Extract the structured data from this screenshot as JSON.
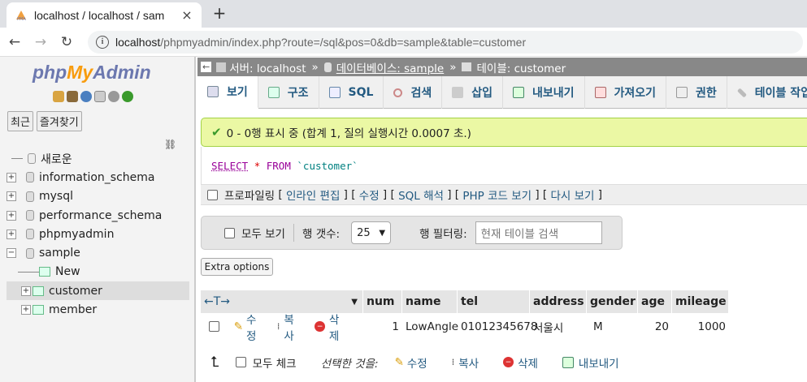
{
  "browser": {
    "tab_title": "localhost / localhost / sam",
    "tab_close": "×",
    "new_tab": "+",
    "back": "←",
    "forward": "→",
    "reload": "↻",
    "url_host": "localhost",
    "url_path": "/phpmyadmin/index.php?route=/sql&pos=0&db=sample&table=customer"
  },
  "sidebar": {
    "logo_php": "php",
    "logo_my": "My",
    "logo_admin": "Admin",
    "recent_tab": "최근",
    "favorites_tab": "즐겨찾기",
    "tree": [
      {
        "label": "새로운",
        "expander": ""
      },
      {
        "label": "information_schema",
        "expander": "+"
      },
      {
        "label": "mysql",
        "expander": "+"
      },
      {
        "label": "performance_schema",
        "expander": "+"
      },
      {
        "label": "phpmyadmin",
        "expander": "+"
      },
      {
        "label": "sample",
        "expander": "−"
      },
      {
        "label": "New",
        "expander": ""
      },
      {
        "label": "customer",
        "expander": "+"
      },
      {
        "label": "member",
        "expander": "+"
      }
    ]
  },
  "breadcrumb": {
    "server": "서버: localhost",
    "database": "데이터베이스: sample",
    "table": "테이블: customer",
    "separator": "»"
  },
  "tabs": [
    "보기",
    "구조",
    "SQL",
    "검색",
    "삽입",
    "내보내기",
    "가져오기",
    "권한",
    "테이블 작업"
  ],
  "message": "0 - 0행 표시 중 (합계 1, 질의 실행시간 0.0007 초.)",
  "sql": {
    "select": "SELECT",
    "star": "*",
    "from": "FROM",
    "table": "`customer`"
  },
  "profiling": {
    "label": "프로파일링",
    "links": [
      "인라인 편집",
      "수정",
      "SQL 해석",
      "PHP 코드 보기",
      "다시 보기"
    ]
  },
  "nav": {
    "show_all": "모두 보기",
    "row_count_label": "행 갯수:",
    "row_count_value": "25",
    "filter_label": "행 필터링:",
    "filter_placeholder": "현재 테이블 검색"
  },
  "extra_options": "Extra options",
  "table": {
    "columns": [
      "num",
      "name",
      "tel",
      "address",
      "gender",
      "age",
      "mileage"
    ],
    "rows": [
      {
        "num": "1",
        "name": "LowAngle",
        "tel": "01012345678",
        "address": "서울시",
        "gender": "M",
        "age": "20",
        "mileage": "1000"
      }
    ],
    "row_actions": [
      "수정",
      "복사",
      "삭제"
    ]
  },
  "bottom": {
    "check_all": "모두 체크",
    "with_selected": "선택한 것을:",
    "actions": [
      "수정",
      "복사",
      "삭제",
      "내보내기"
    ]
  },
  "colors": {
    "accent_link": "#235a81",
    "success_bg": "#ebf8a4",
    "breadcrumb_bg": "#888888"
  }
}
